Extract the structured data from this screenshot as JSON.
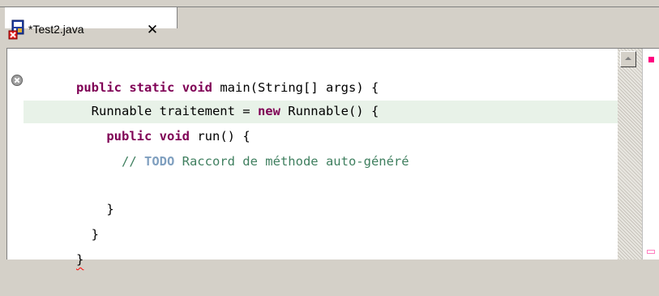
{
  "tab": {
    "title": "*Test2.java",
    "close_label": "✕"
  },
  "icons": {
    "file_icon": "java-file-error-icon",
    "gutter_error": "error-marker-icon",
    "close": "close-icon"
  },
  "code": {
    "line1": {
      "indent": "  ",
      "kw1": "public",
      "sp1": " ",
      "kw2": "static",
      "sp2": " ",
      "kw3": "void",
      "rest": " main(String[] args) {"
    },
    "line2": {
      "pre": "    Runnable traitement = ",
      "kw": "new",
      "rest": " Runnable() {"
    },
    "line3": {
      "indent": "      ",
      "kw1": "public",
      "sp1": " ",
      "kw2": "void",
      "rest": " run() {"
    },
    "line4": {
      "prefix": "        // ",
      "todo": "TODO",
      "text": " Raccord de méthode auto-généré"
    },
    "line5": {
      "text": "      }"
    },
    "line6": {
      "text": "    }"
    },
    "line7": {
      "indent": "  ",
      "brace": "}"
    }
  },
  "colors": {
    "keyword": "#7f0055",
    "comment": "#3f7f5f",
    "todo": "#7f9fbf",
    "current_line": "#e8f2e8",
    "error_mark": "#ff0080"
  }
}
